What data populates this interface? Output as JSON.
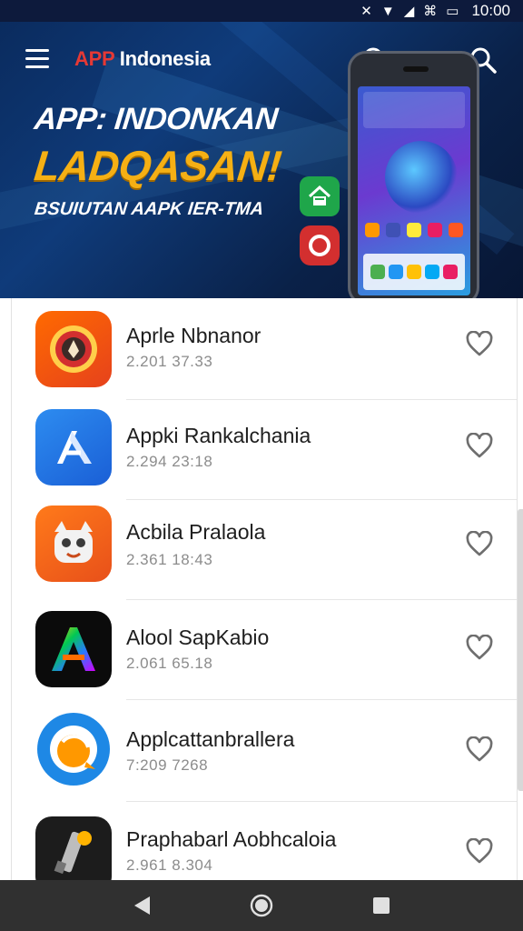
{
  "status_bar": {
    "time": "10:00",
    "icons": [
      "mute-icon",
      "wifi-icon",
      "signal-icon",
      "nfc-icon",
      "battery-icon"
    ]
  },
  "header": {
    "brand_accent": "APP",
    "brand_rest": " Indonesia",
    "brand_accent_color": "#e53935"
  },
  "promo": {
    "line1": "APP: INDONKAN",
    "line2": "LADQASAN!",
    "line3": "BSUIUTAN AAPK IER-TMA",
    "highlight_color": "#f5b014"
  },
  "apps": [
    {
      "name": "Aprle Nbnanor",
      "meta": "2.201 37.33",
      "icon": "compass-gear-icon"
    },
    {
      "name": "Appki Rankalchania",
      "meta": "2.294 23:18",
      "icon": "arrow-a-icon"
    },
    {
      "name": "Acbila Pralaola",
      "meta": "2.361 18:43",
      "icon": "cat-mascot-icon"
    },
    {
      "name": "Alool SapKabio",
      "meta": "2.061 65.18",
      "icon": "rainbow-a-icon"
    },
    {
      "name": "Applcattanbrallera",
      "meta": "7:209 7268",
      "icon": "chat-bubble-icon"
    },
    {
      "name": "Praphabarl Aobhcaloia",
      "meta": "2.961 8.304",
      "icon": "pen-icon"
    }
  ],
  "colors": {
    "hero_dark": "#0a2148",
    "list_text": "#1e1e1e",
    "meta_text": "#8c8c8c",
    "navbar": "#303030"
  }
}
